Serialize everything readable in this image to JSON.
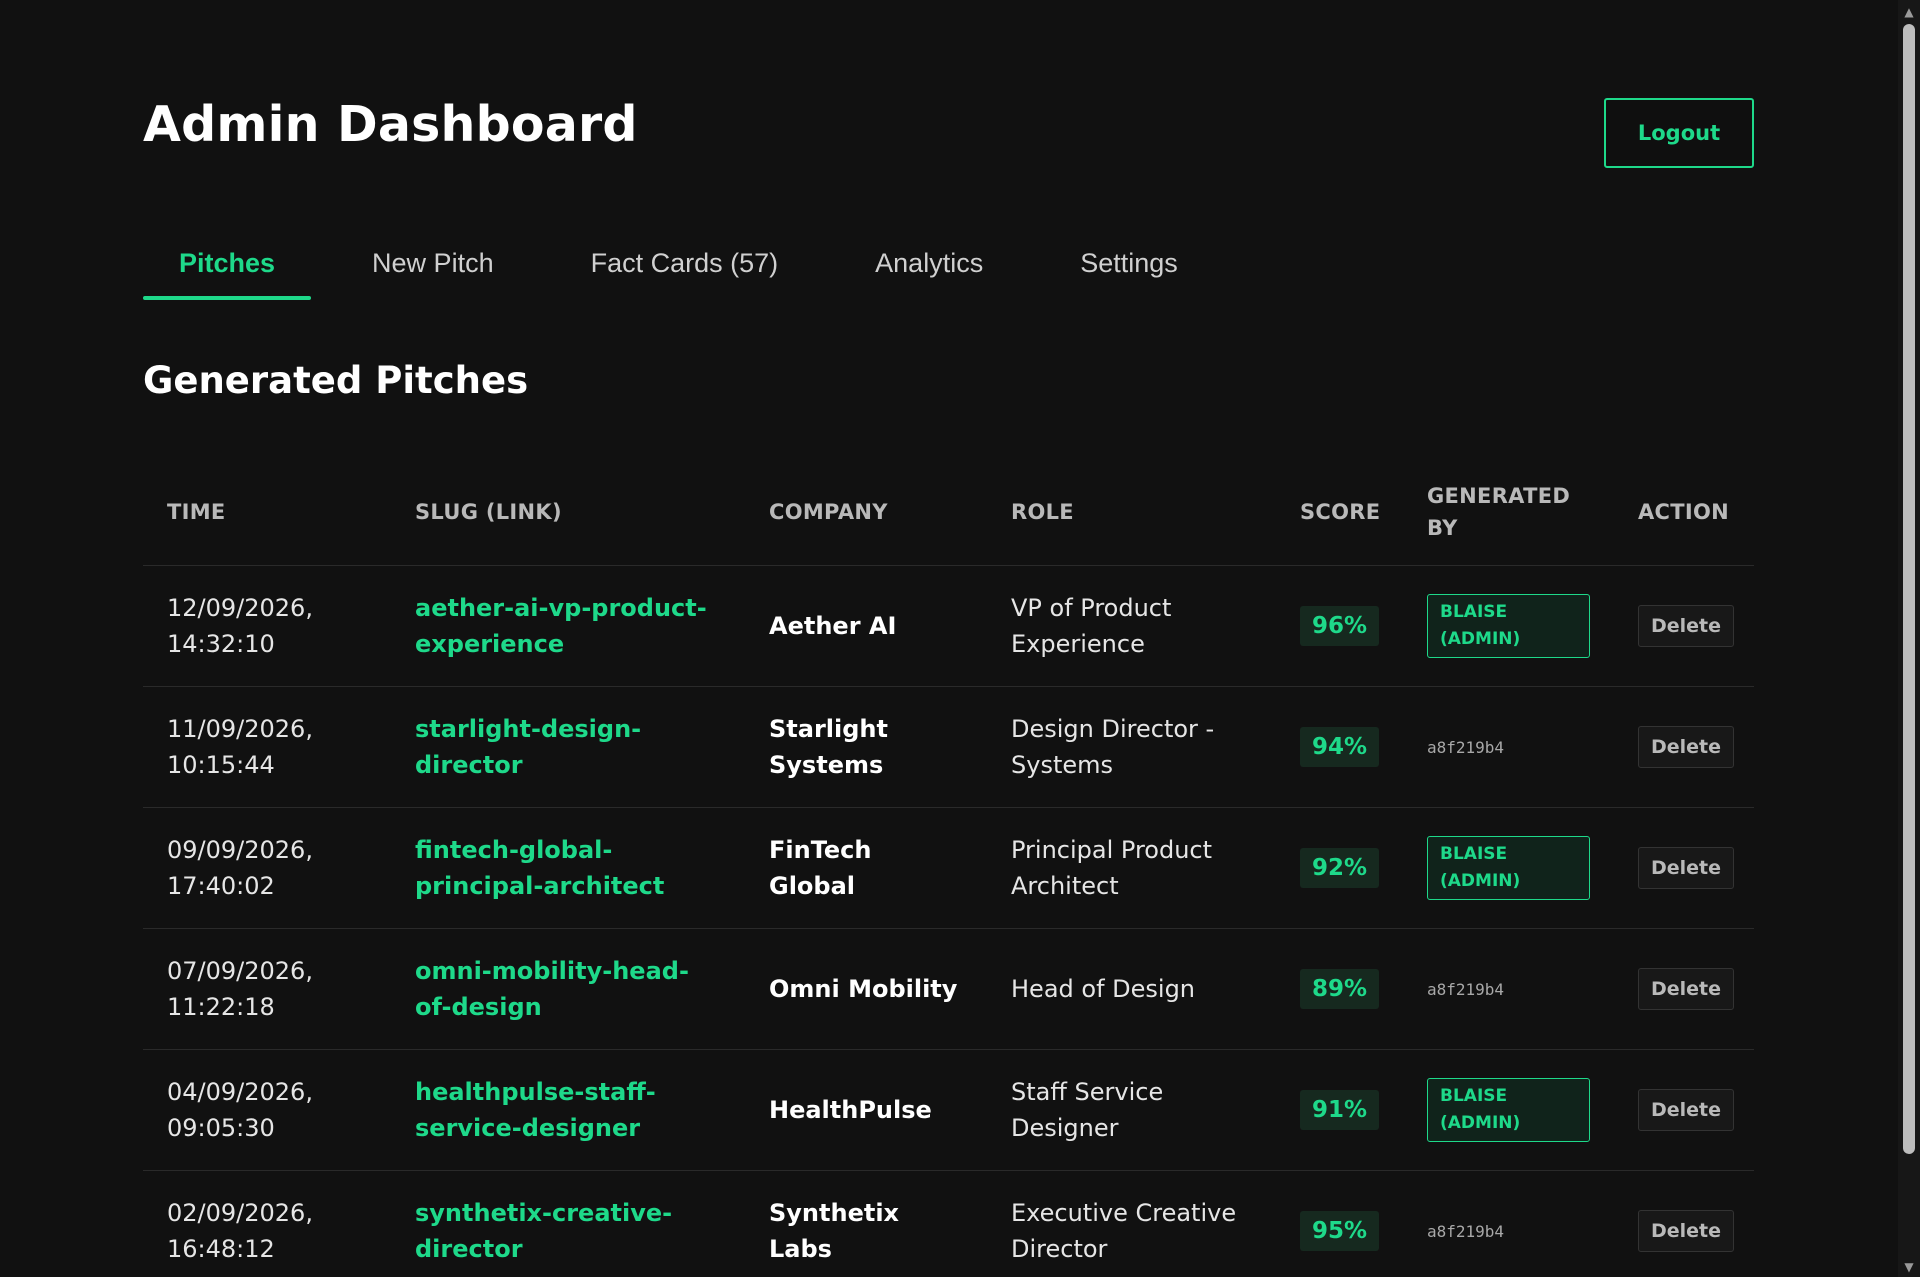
{
  "header": {
    "title": "Admin Dashboard",
    "logout_label": "Logout"
  },
  "tabs": [
    {
      "label": "Pitches",
      "active": true
    },
    {
      "label": "New Pitch",
      "active": false
    },
    {
      "label": "Fact Cards (57)",
      "active": false
    },
    {
      "label": "Analytics",
      "active": false
    },
    {
      "label": "Settings",
      "active": false
    }
  ],
  "section": {
    "title": "Generated Pitches"
  },
  "table": {
    "columns": [
      "TIME",
      "SLUG (LINK)",
      "COMPANY",
      "ROLE",
      "SCORE",
      "GENERATED BY",
      "ACTION"
    ],
    "delete_label": "Delete",
    "rows": [
      {
        "time": "12/09/2026, 14:32:10",
        "slug": "aether-ai-vp-product-experience",
        "company": "Aether AI",
        "role": "VP of Product Experience",
        "score": "96%",
        "generated_by": "BLAISE (ADMIN)",
        "generated_by_admin": true
      },
      {
        "time": "11/09/2026, 10:15:44",
        "slug": "starlight-design-director",
        "company": "Starlight Systems",
        "role": "Design Director - Systems",
        "score": "94%",
        "generated_by": "a8f219b4",
        "generated_by_admin": false
      },
      {
        "time": "09/09/2026, 17:40:02",
        "slug": "fintech-global-principal-architect",
        "company": "FinTech Global",
        "role": "Principal Product Architect",
        "score": "92%",
        "generated_by": "BLAISE (ADMIN)",
        "generated_by_admin": true
      },
      {
        "time": "07/09/2026, 11:22:18",
        "slug": "omni-mobility-head-of-design",
        "company": "Omni Mobility",
        "role": "Head of Design",
        "score": "89%",
        "generated_by": "a8f219b4",
        "generated_by_admin": false
      },
      {
        "time": "04/09/2026, 09:05:30",
        "slug": "healthpulse-staff-service-designer",
        "company": "HealthPulse",
        "role": "Staff Service Designer",
        "score": "91%",
        "generated_by": "BLAISE (ADMIN)",
        "generated_by_admin": true
      },
      {
        "time": "02/09/2026, 16:48:12",
        "slug": "synthetix-creative-director",
        "company": "Synthetix Labs",
        "role": "Executive Creative Director",
        "score": "95%",
        "generated_by": "a8f219b4",
        "generated_by_admin": false
      }
    ]
  },
  "scrollbar": {
    "up_icon": "▲",
    "down_icon": "▼"
  },
  "colors": {
    "accent": "#1ed98a",
    "background": "#111111"
  }
}
